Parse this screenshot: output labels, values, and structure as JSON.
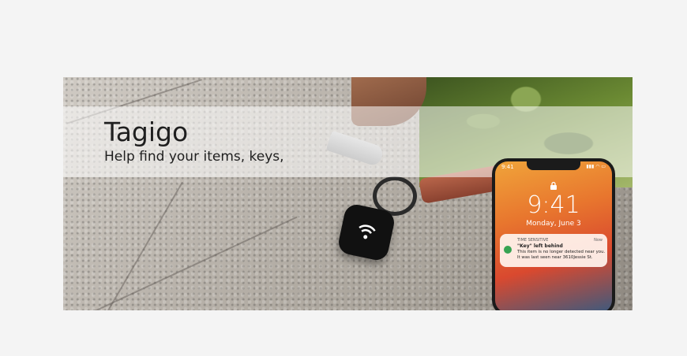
{
  "brand": "Tagigo",
  "tagline": "Help find your items, keys,",
  "phone": {
    "status_time": "9:41",
    "status_icons": "▮▮▮ ◠ ▭",
    "lock_time": "9:41",
    "date": "Monday, June 3",
    "notification": {
      "tag": "TIME SENSITIVE",
      "time": "Now",
      "title": "\"Key\" left behind",
      "body": "This item is no longer detected near you. It was last seen near 3610Jessie St."
    }
  },
  "colors": {
    "background": "#f4f4f4",
    "text": "#1f1f1f",
    "notification_icon": "#37a352"
  },
  "icons": [
    "lock-icon",
    "find-my-icon",
    "wifi-logo-icon"
  ]
}
